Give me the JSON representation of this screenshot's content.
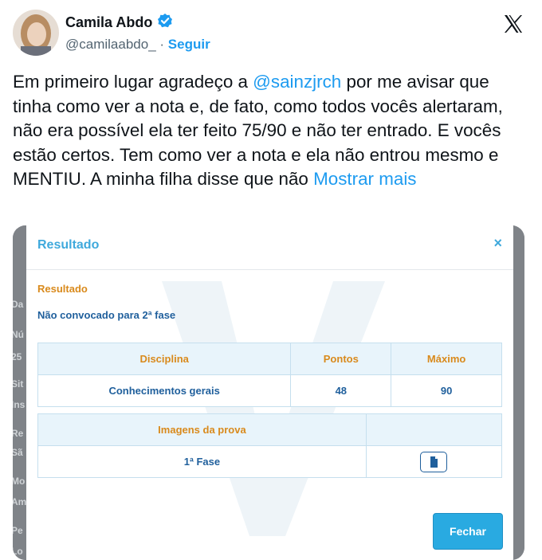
{
  "user": {
    "name": "Camila Abdo",
    "handle": "@camilaabdo_",
    "separator": "·",
    "follow_label": "Seguir"
  },
  "tweet": {
    "text_before": "Em primeiro lugar agradeço a ",
    "mention": "@sainzjrch",
    "text_after": " por me avisar que tinha como ver a nota e, de fato, como todos vocês alertaram, não era possível ela ter feito 75/90 e não ter entrado. E vocês estão certos. Tem como ver a nota e ela não entrou mesmo e MENTIU. A minha filha disse que não ",
    "show_more": "Mostrar mais"
  },
  "colors": {
    "accent": "#1d9bf0",
    "modal_blue": "#3fa9dc",
    "orange": "#d98a1c",
    "navy": "#1f5f9c"
  },
  "background_labels": [
    "Da",
    "Nú",
    "25",
    "Sit",
    "Ins",
    "Re",
    "Sã",
    "Mo",
    "Am",
    "Pe",
    "Lo"
  ],
  "modal": {
    "title": "Resultado",
    "close_icon": "×",
    "result_label": "Resultado",
    "result_status": "Não convocado para 2ª fase",
    "scores": {
      "headers": [
        "Disciplina",
        "Pontos",
        "Máximo"
      ],
      "rows": [
        [
          "Conhecimentos gerais",
          "48",
          "90"
        ]
      ]
    },
    "images": {
      "header": "Imagens da prova",
      "row_label": "1ª Fase",
      "icon": "document-icon"
    },
    "close_button": "Fechar"
  }
}
